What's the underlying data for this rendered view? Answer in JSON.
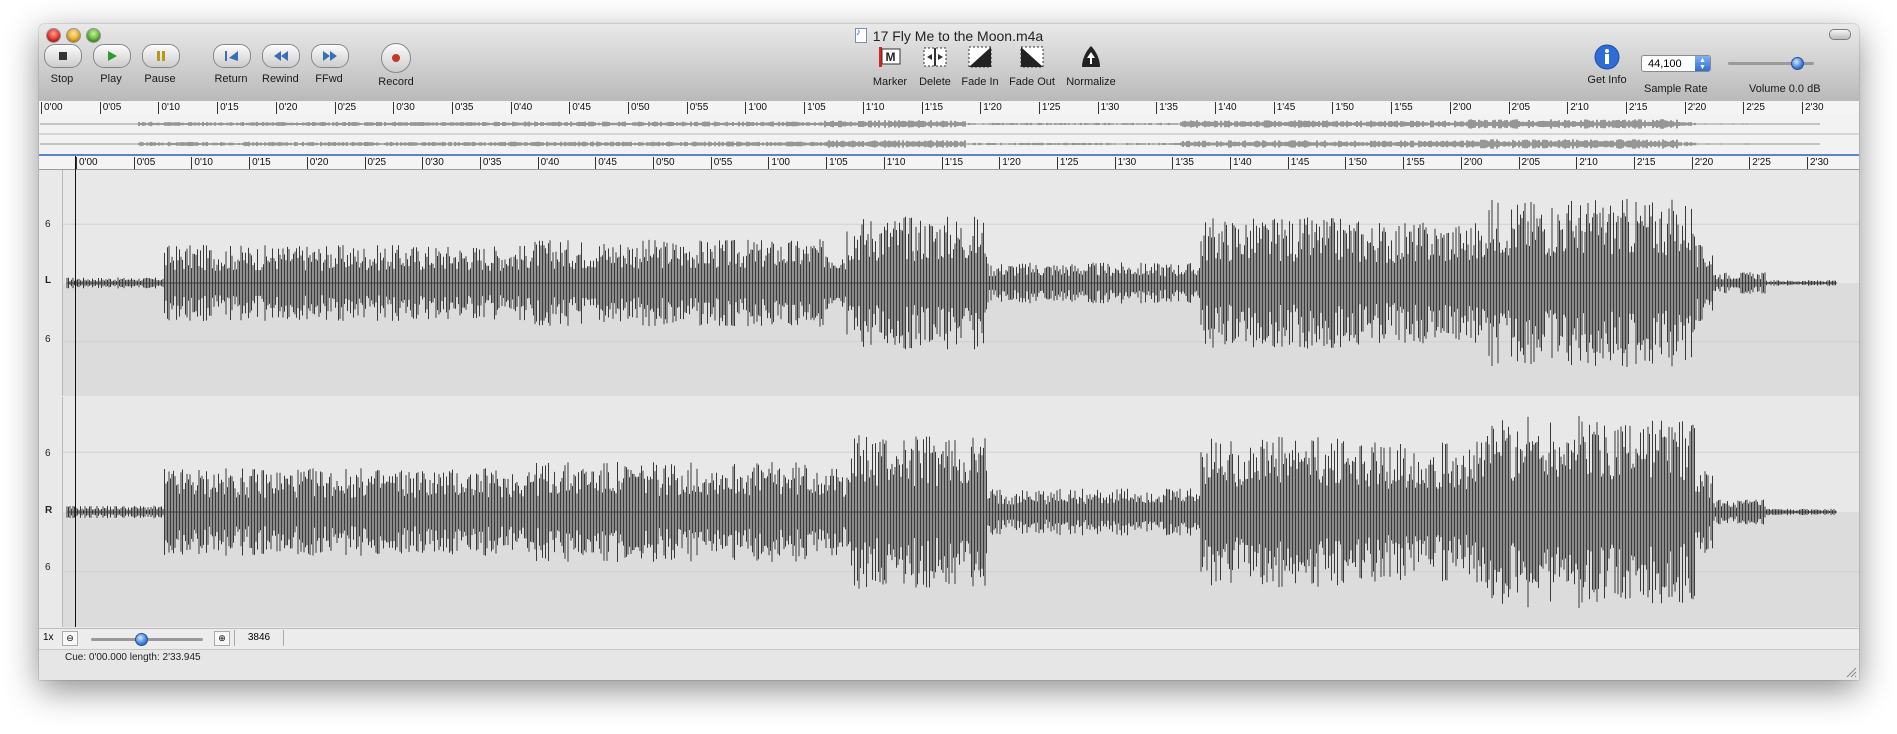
{
  "window": {
    "title": "17 Fly Me to the Moon.m4a"
  },
  "toolbar": {
    "transport": [
      {
        "label": "Stop",
        "icon": "stop-icon"
      },
      {
        "label": "Play",
        "icon": "play-icon"
      },
      {
        "label": "Pause",
        "icon": "pause-icon"
      },
      {
        "label": "Return",
        "icon": "return-icon"
      },
      {
        "label": "Rewind",
        "icon": "rewind-icon"
      },
      {
        "label": "FFwd",
        "icon": "fast-forward-icon"
      },
      {
        "label": "Record",
        "icon": "record-icon"
      }
    ],
    "edit": [
      {
        "label": "Marker",
        "icon": "marker-icon"
      },
      {
        "label": "Delete",
        "icon": "delete-icon"
      },
      {
        "label": "Fade In",
        "icon": "fade-in-icon"
      },
      {
        "label": "Fade Out",
        "icon": "fade-out-icon"
      },
      {
        "label": "Normalize",
        "icon": "normalize-icon"
      }
    ],
    "get_info_label": "Get Info",
    "sample_rate_label": "Sample Rate",
    "sample_rate_value": "44,100",
    "volume_label": "Volume 0.0 dB",
    "volume_level": 0.8
  },
  "timeline": {
    "overview_ticks": [
      "0'00",
      "0'05",
      "0'10",
      "0'15",
      "0'20",
      "0'25",
      "0'30",
      "0'35",
      "0'40",
      "0'45",
      "0'50",
      "0'55",
      "1'00",
      "1'05",
      "1'10",
      "1'15",
      "1'20",
      "1'25",
      "1'30",
      "1'35",
      "1'40",
      "1'45",
      "1'50",
      "1'55",
      "2'00",
      "2'05",
      "2'10",
      "2'15",
      "2'20",
      "2'25",
      "2'30"
    ],
    "detail_ticks": [
      "0'00",
      "0'05",
      "0'10",
      "0'15",
      "0'20",
      "0'25",
      "0'30",
      "0'35",
      "0'40",
      "0'45",
      "0'50",
      "0'55",
      "1'00",
      "1'05",
      "1'10",
      "1'15",
      "1'20",
      "1'25",
      "1'30",
      "1'35",
      "1'40",
      "1'45",
      "1'50",
      "1'55",
      "2'00",
      "2'05",
      "2'10",
      "2'15",
      "2'20",
      "2'25",
      "2'30"
    ]
  },
  "channels": [
    {
      "label": "L",
      "scale_top": "6",
      "scale_bottom": "6"
    },
    {
      "label": "R",
      "scale_top": "6",
      "scale_bottom": "6"
    }
  ],
  "zoom": {
    "level_label": "1x",
    "value": "3846",
    "slider_level": 0.45
  },
  "status": {
    "text": "Cue: 0'00.000 length: 2'33.945"
  },
  "colors": {
    "waveform": "#3a3a3a",
    "selection_line": "#5a86c9",
    "accent": "#3d7fe0"
  }
}
